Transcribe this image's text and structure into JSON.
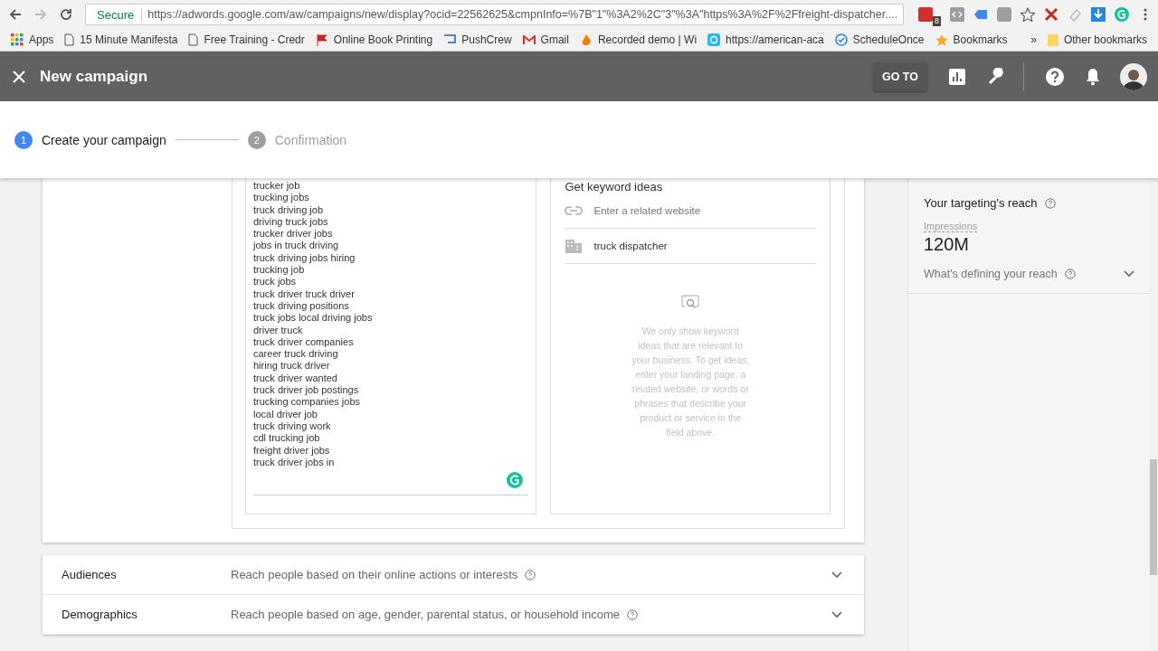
{
  "browser": {
    "security_label": "Secure",
    "url": "https://adwords.google.com/aw/campaigns/new/display?ocid=22562625&cmpnInfo=%7B\"1\"%3A2%2C\"3\"%3A\"https%3A%2F%2Ffreight-dispatcher....",
    "extension_badge": "8",
    "bookmarks": [
      {
        "label": "Apps"
      },
      {
        "label": "15 Minute Manifesta"
      },
      {
        "label": "Free Training - Credr"
      },
      {
        "label": "Online Book Printing"
      },
      {
        "label": "PushCrew"
      },
      {
        "label": "Gmail"
      },
      {
        "label": "Recorded demo | Wi"
      },
      {
        "label": "https://american-aca"
      },
      {
        "label": "ScheduleOnce"
      },
      {
        "label": "Bookmarks"
      }
    ],
    "overflow": "»",
    "other_bookmarks": "Other bookmarks"
  },
  "app_bar": {
    "title": "New campaign",
    "goto": "GO TO"
  },
  "stepper": [
    {
      "number": "1",
      "label": "Create your campaign",
      "selected": true
    },
    {
      "number": "2",
      "label": "Confirmation",
      "selected": false
    }
  ],
  "keywords": [
    "trucker job",
    "trucking jobs",
    "truck driving job",
    "driving truck jobs",
    "trucker driver jobs",
    "jobs in truck driving",
    "truck driving jobs hiring",
    "trucking job",
    "truck jobs",
    "truck driver truck driver",
    "truck driving positions",
    "truck jobs local driving jobs",
    "driver truck",
    "truck driver companies",
    "career truck driving",
    "hiring truck driver",
    "truck driver wanted",
    "truck driver job postings",
    "trucking companies jobs",
    "local driver job",
    "truck driving work",
    "cdl trucking job",
    "freight driver jobs",
    "truck driver jobs in"
  ],
  "keyword_ideas": {
    "title": "Get keyword ideas",
    "website_placeholder": "Enter a related website",
    "product_value": "truck dispatcher",
    "hint": "We only show keyword ideas that are relevant to your business. To get ideas, enter your landing page, a related website, or words or phrases that describe your product or service in the field above."
  },
  "sections": [
    {
      "title": "Audiences",
      "description": "Reach people based on their online actions or interests"
    },
    {
      "title": "Demographics",
      "description": "Reach people based on age, gender, parental status, or household income"
    }
  ],
  "reach": {
    "title": "Your targeting's reach",
    "metric_label": "Impressions",
    "metric_value": "120M",
    "defining": "What's defining your reach"
  }
}
